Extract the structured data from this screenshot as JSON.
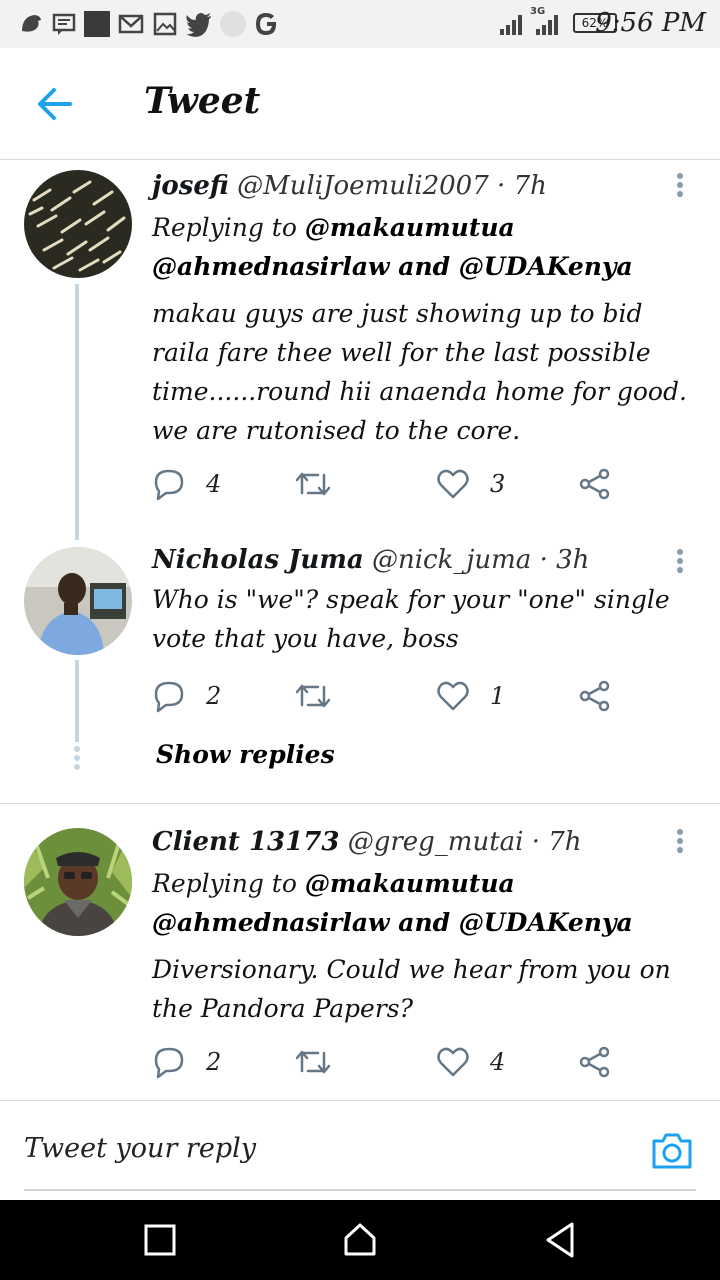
{
  "status_bar": {
    "time": "9:56 PM",
    "battery": "62%",
    "network": "3G",
    "icons": [
      "bird-icon",
      "message-icon",
      "square-icon",
      "mail-icon",
      "image-icon",
      "twitter-icon",
      "email-icon",
      "google-icon",
      "signal-icon"
    ]
  },
  "header": {
    "title": "Tweet",
    "back_icon": "arrow-left-icon"
  },
  "tweets": [
    {
      "name": "josefi",
      "handle": "@MuliJoemuli2007",
      "time": "· 7h",
      "replying_label": "Replying to",
      "mentions": "@makaumutua @ahmednasirlaw and @UDAKenya",
      "text": "makau guys are just showing up to bid raila fare thee well for the last possible time......round hii anaenda home for good. we are rutonised to the core.",
      "replies": "4",
      "retweets": "",
      "likes": "3"
    },
    {
      "name": "Nicholas Juma",
      "handle": "@nick_juma",
      "time": "· 3h",
      "text": "Who is \"we\"? speak for your \"one\" single vote that you have, boss",
      "replies": "2",
      "retweets": "",
      "likes": "1"
    },
    {
      "name": "Client 13173",
      "handle": "@greg_mutai",
      "time": "· 7h",
      "replying_label": "Replying to",
      "mentions": "@makaumutua @ahmednasirlaw and @UDAKenya",
      "text": "Diversionary. Could we hear from you on the Pandora Papers?",
      "replies": "2",
      "retweets": "",
      "likes": "4"
    }
  ],
  "show_replies": "Show replies",
  "reply_bar": {
    "placeholder": "Tweet your reply",
    "camera_icon": "camera-icon"
  },
  "colors": {
    "accent": "#1da1f2",
    "icon_gray": "#657786",
    "divider": "#d9d9d9",
    "thread_line": "#c5d5e0"
  }
}
